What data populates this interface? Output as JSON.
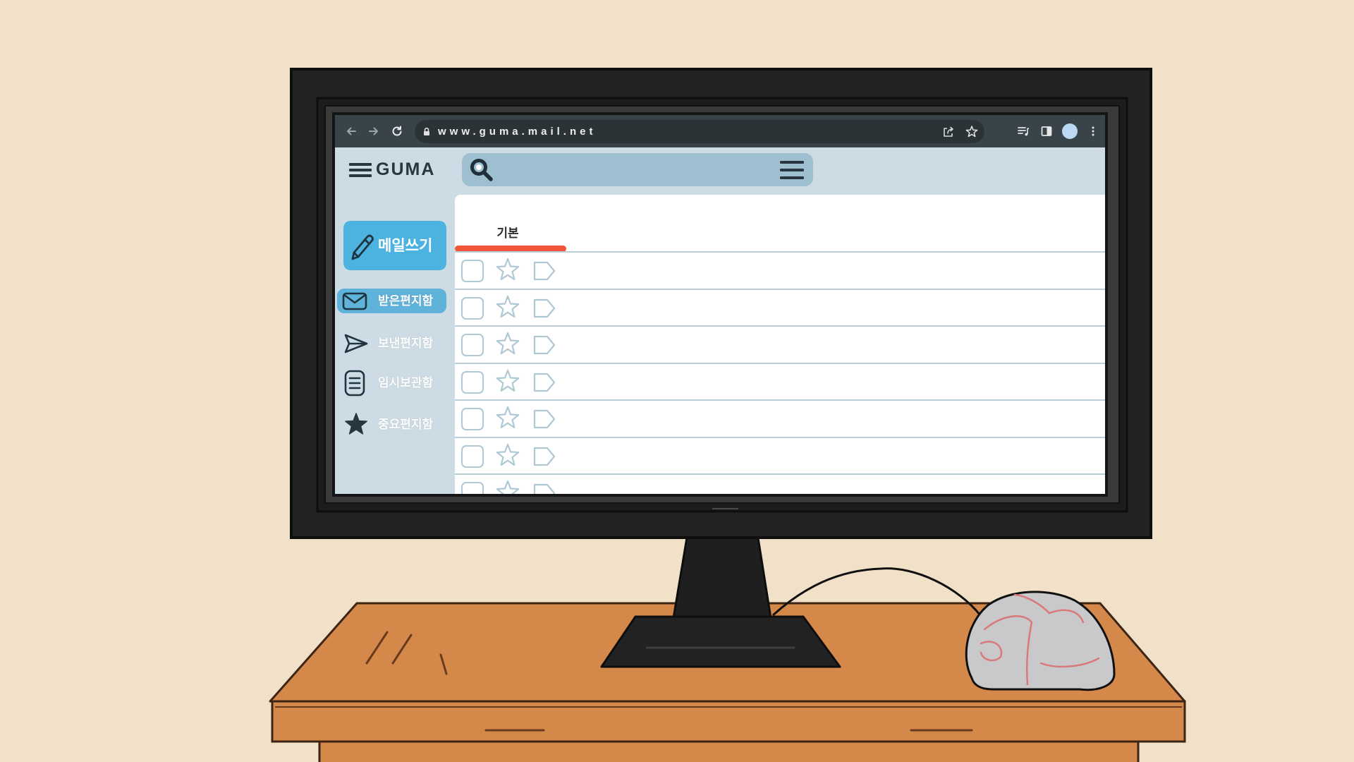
{
  "colors": {
    "wall": "#F2E1C9",
    "desk": "#D4884A",
    "browser_chrome": "#39434A",
    "app_background": "#CDDCE4",
    "search_bar": "#9DBFCF",
    "compose_button": "#4CB3E0",
    "selected_folder": "#5FB2DA",
    "tab_underline": "#F0553A",
    "divider": "#B9CDD7",
    "row_icon": "#AFC8D4"
  },
  "browser": {
    "url": "www.guma.mail.net",
    "icons": [
      "back-arrow-icon",
      "forward-arrow-icon",
      "reload-icon",
      "lock-icon",
      "share-icon",
      "bookmark-star-icon",
      "media-playlist-icon",
      "side-panel-icon",
      "profile-avatar",
      "more-menu-icon"
    ]
  },
  "app": {
    "name": "GUMA",
    "compose_label": "메일쓰기",
    "folders": [
      {
        "label": "받은편지함",
        "icon": "envelope-icon",
        "selected": true
      },
      {
        "label": "보낸편지함",
        "icon": "paper-plane-icon",
        "selected": false
      },
      {
        "label": "임시보관함",
        "icon": "document-icon",
        "selected": false
      },
      {
        "label": "중요편지함",
        "icon": "star-filled-icon",
        "selected": false
      }
    ],
    "tabs": [
      {
        "label": "기본",
        "active": true
      }
    ],
    "mail_rows": [
      {
        "checked": false,
        "starred": false
      },
      {
        "checked": false,
        "starred": false
      },
      {
        "checked": false,
        "starred": false
      },
      {
        "checked": false,
        "starred": false
      },
      {
        "checked": false,
        "starred": false
      },
      {
        "checked": false,
        "starred": false
      },
      {
        "checked": false,
        "starred": false
      }
    ]
  }
}
